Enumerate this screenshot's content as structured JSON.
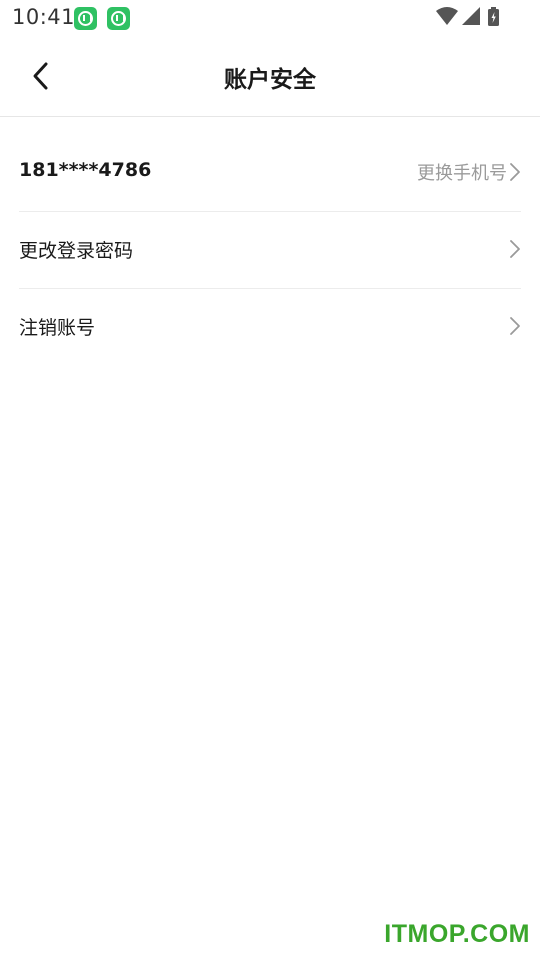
{
  "status_bar": {
    "time": "10:41",
    "notification_icons": [
      "app-notification-icon",
      "app-notification-icon"
    ],
    "system_icons": [
      "wifi-icon",
      "cellular-signal-icon",
      "battery-charging-icon"
    ],
    "notification_color": "#2fc163"
  },
  "nav": {
    "title": "账户安全",
    "back_icon": "chevron-left-icon"
  },
  "settings": {
    "phone": {
      "value": "181****4786",
      "action_label": "更换手机号"
    },
    "change_password": {
      "label": "更改登录密码"
    },
    "deactivate_account": {
      "label": "注销账号"
    }
  },
  "watermark": {
    "text": "ITMOP.COM",
    "color": "#3aa62c"
  }
}
